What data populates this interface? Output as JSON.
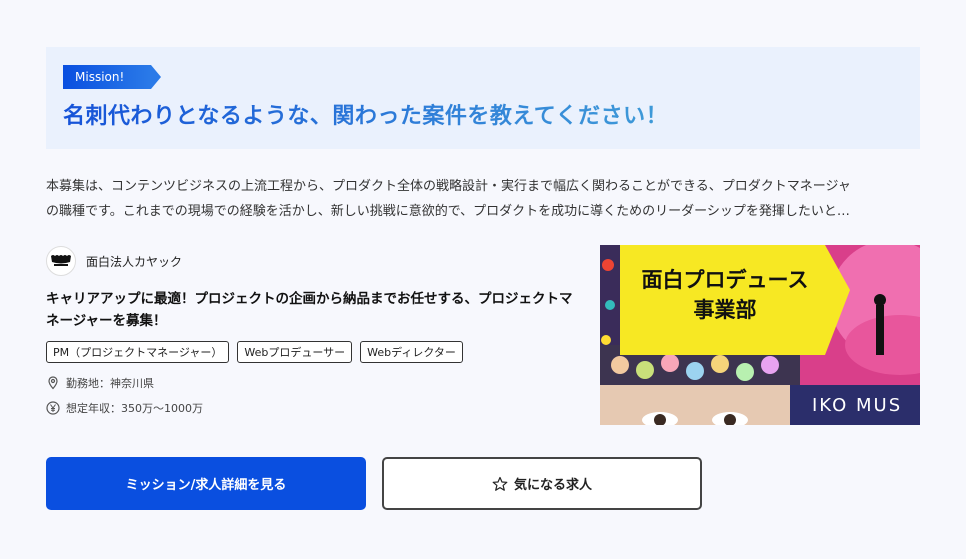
{
  "mission": {
    "tag": "Mission!",
    "title": "名刺代わりとなるような、関わった案件を教えてください！"
  },
  "description": {
    "line1": "本募集は、コンテンツビジネスの上流工程から、プロダクト全体の戦略設計・実行まで幅広く関わることができる、プロダクトマネージャ",
    "line2": "の職種です。これまでの現場での経験を活かし、新しい挑戦に意欲的で、プロダクトを成功に導くためのリーダーシップを発揮したいと…"
  },
  "company": {
    "name": "面白法人カヤック",
    "logo_icon": "kayac-logo-icon"
  },
  "job": {
    "title": "キャリアアップに最適！プロジェクトの企画から納品までお任せする、プロジェクトマネージャーを募集！",
    "tags": [
      "PM（プロジェクトマネージャー）",
      "Webプロデューサー",
      "Webディレクター"
    ],
    "location": "勤務地：神奈川県",
    "salary": "想定年収：350万〜1000万"
  },
  "hero": {
    "headline_line1": "面白プロデュース",
    "headline_line2": "事業部",
    "bottom_text": "IKO MUS"
  },
  "actions": {
    "primary_label": "ミッション/求人詳細を見る",
    "secondary_label": "気になる求人"
  },
  "colors": {
    "accent": "#0a4fe0",
    "hero_yellow": "#f7e823",
    "background": "#f7f8fd",
    "mission_bg": "#eaf1fd"
  }
}
